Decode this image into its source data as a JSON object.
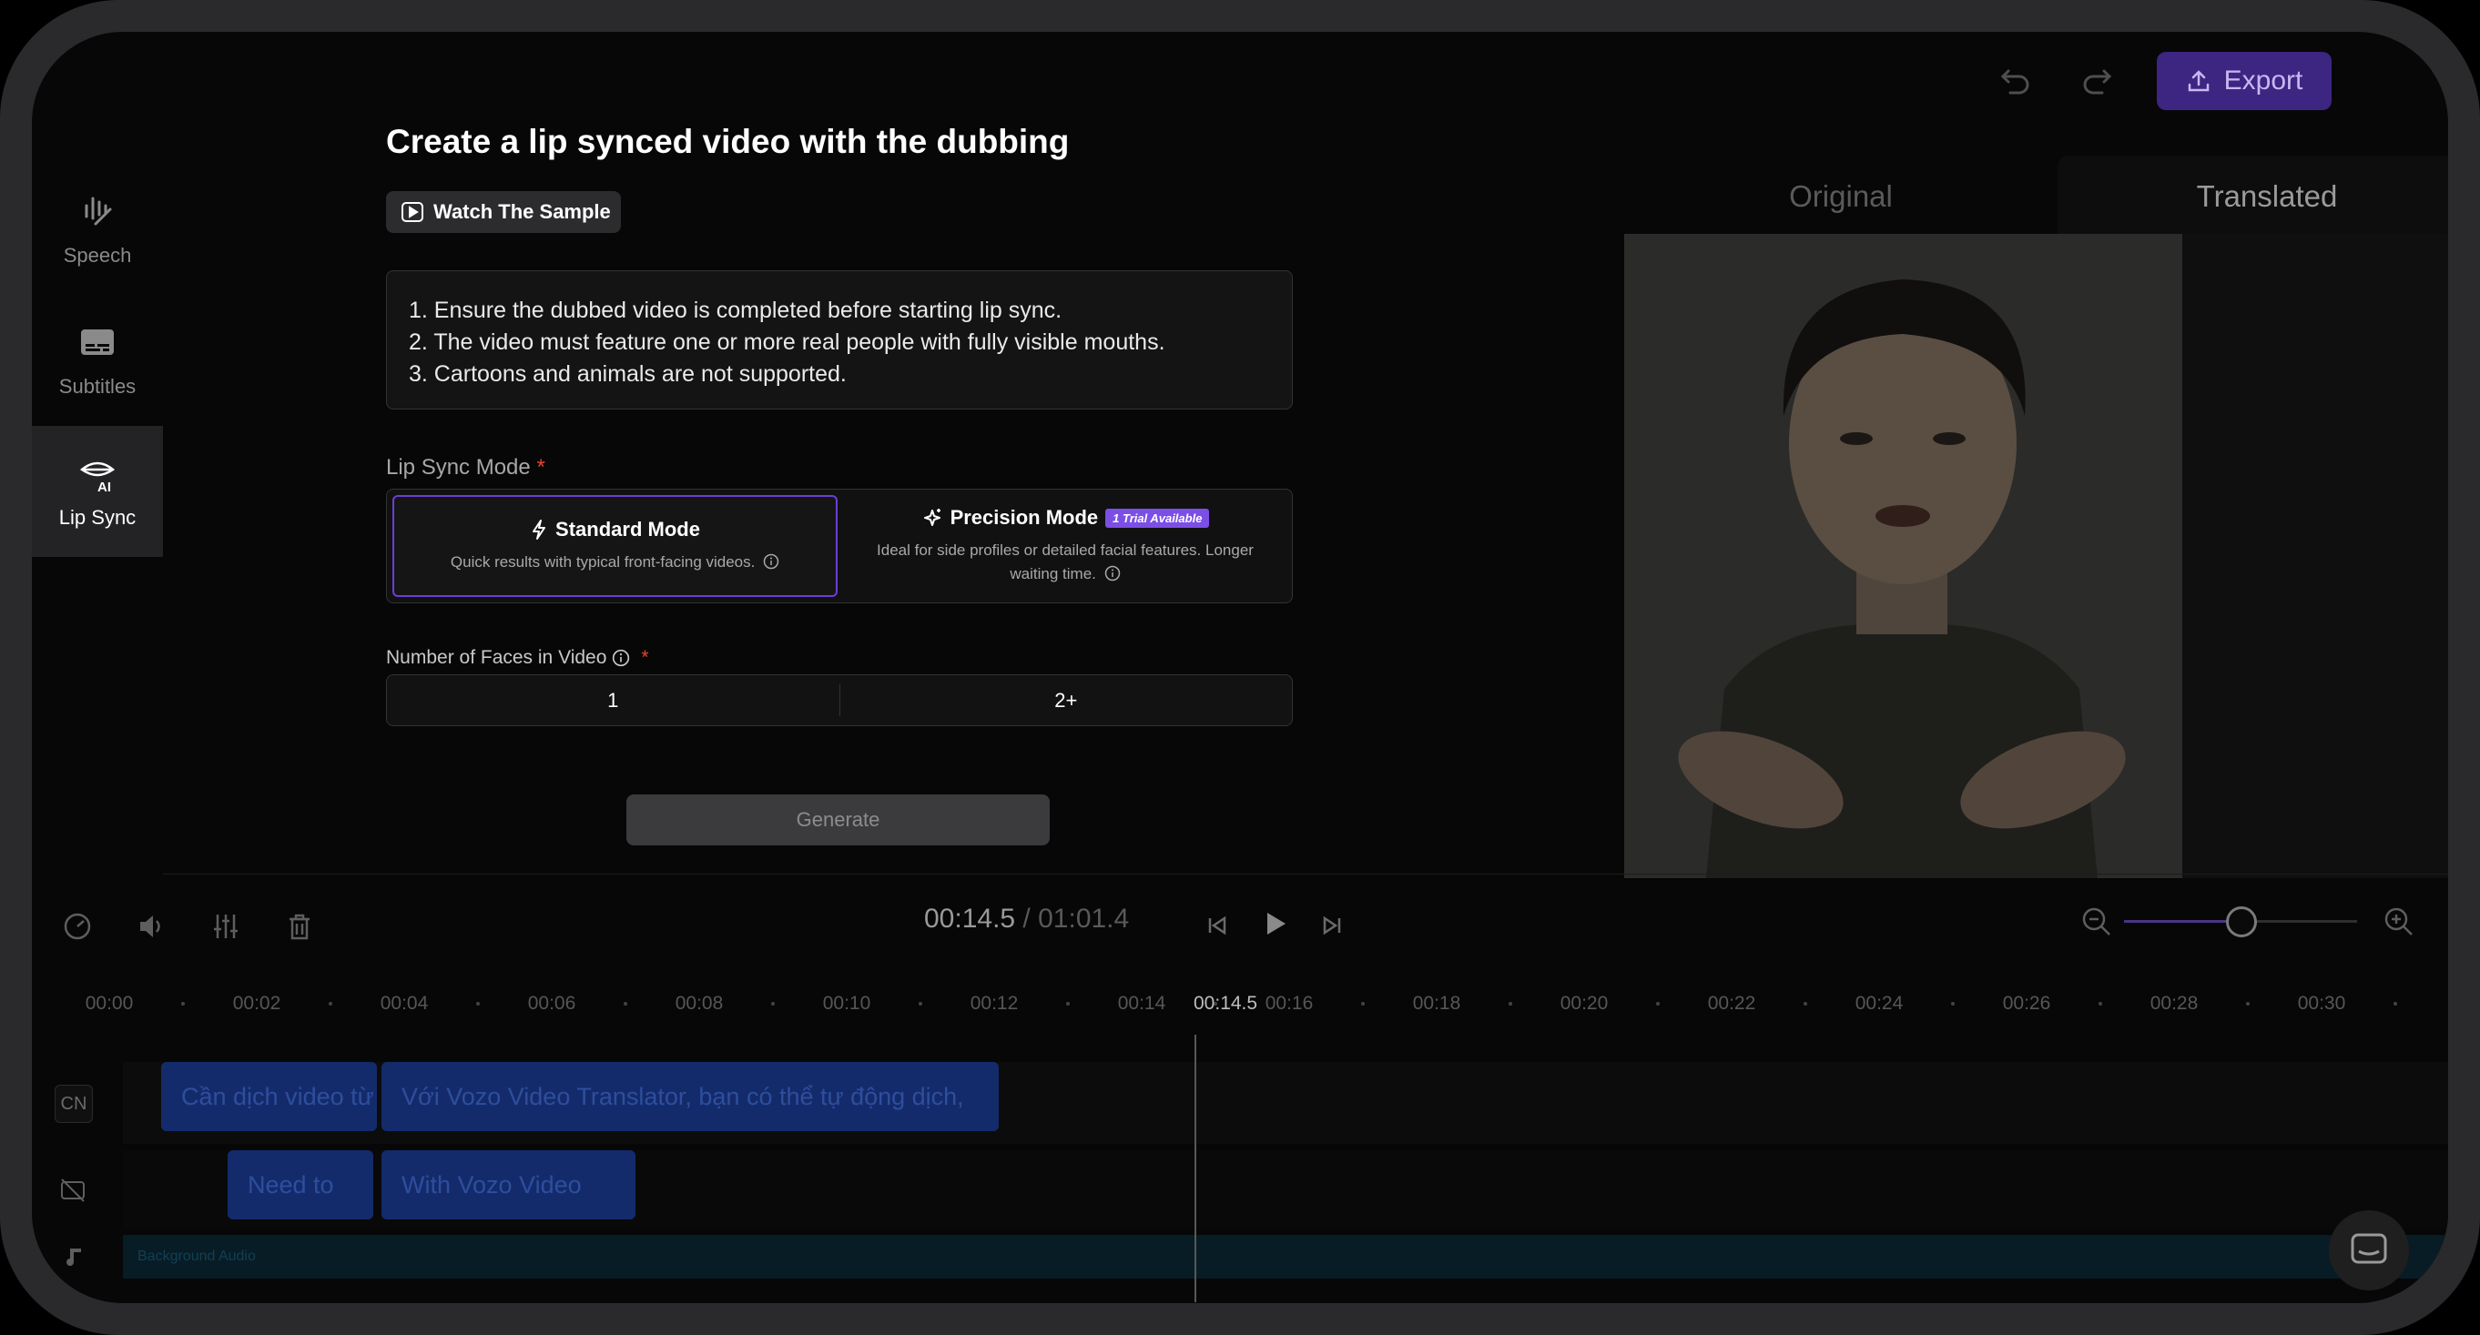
{
  "sidebar": {
    "items": [
      {
        "label": "Speech",
        "icon": "speech-wave-icon"
      },
      {
        "label": "Subtitles",
        "icon": "subtitles-icon"
      },
      {
        "label": "Lip Sync",
        "icon": "lip-sync-ai-icon",
        "active": true
      }
    ]
  },
  "toolbar": {
    "export_label": "Export"
  },
  "lipsync": {
    "title": "Create a lip synced video with the dubbing",
    "sample_button": "Watch The Sample",
    "notes": [
      "1. Ensure the dubbed video is completed before starting lip sync.",
      "2. The video must feature one or more real people with fully visible mouths.",
      "3. Cartoons and animals are not supported."
    ],
    "mode_label": "Lip Sync Mode",
    "required_mark": "*",
    "standard": {
      "title": "Standard Mode",
      "desc": "Quick results with typical front-facing videos."
    },
    "precision": {
      "title": "Precision Mode",
      "badge": "1 Trial Available",
      "desc": "Ideal for side profiles or detailed facial features. Longer waiting time."
    },
    "faces_label": "Number of Faces in Video",
    "faces_options": [
      "1",
      "2+"
    ],
    "generate_label": "Generate"
  },
  "preview": {
    "tab_original": "Original",
    "tab_translated": "Translated"
  },
  "player": {
    "current": "00:14.5",
    "separator": " / ",
    "total": "01:01.4"
  },
  "timeline": {
    "ticks": [
      "00:00",
      "00:02",
      "00:04",
      "00:06",
      "00:08",
      "00:10",
      "00:12",
      "00:14",
      "00:16",
      "00:18",
      "00:20",
      "00:22",
      "00:24",
      "00:26",
      "00:28",
      "00:30"
    ],
    "current_marker": "00:14.5",
    "track_cn_label": "CN",
    "track1_clips": [
      "Cần dịch video từ",
      "Với Vozo Video Translator, bạn có thể tự động dịch,"
    ],
    "track2_clips": [
      "Need to",
      "With Vozo Video"
    ],
    "audio_label": "Background Audio"
  },
  "colors": {
    "accent": "#6a3fd6",
    "export_bg": "#3d2582",
    "badge": "#7b4fe6",
    "required": "#e8452c",
    "clip": "#142b6b"
  }
}
